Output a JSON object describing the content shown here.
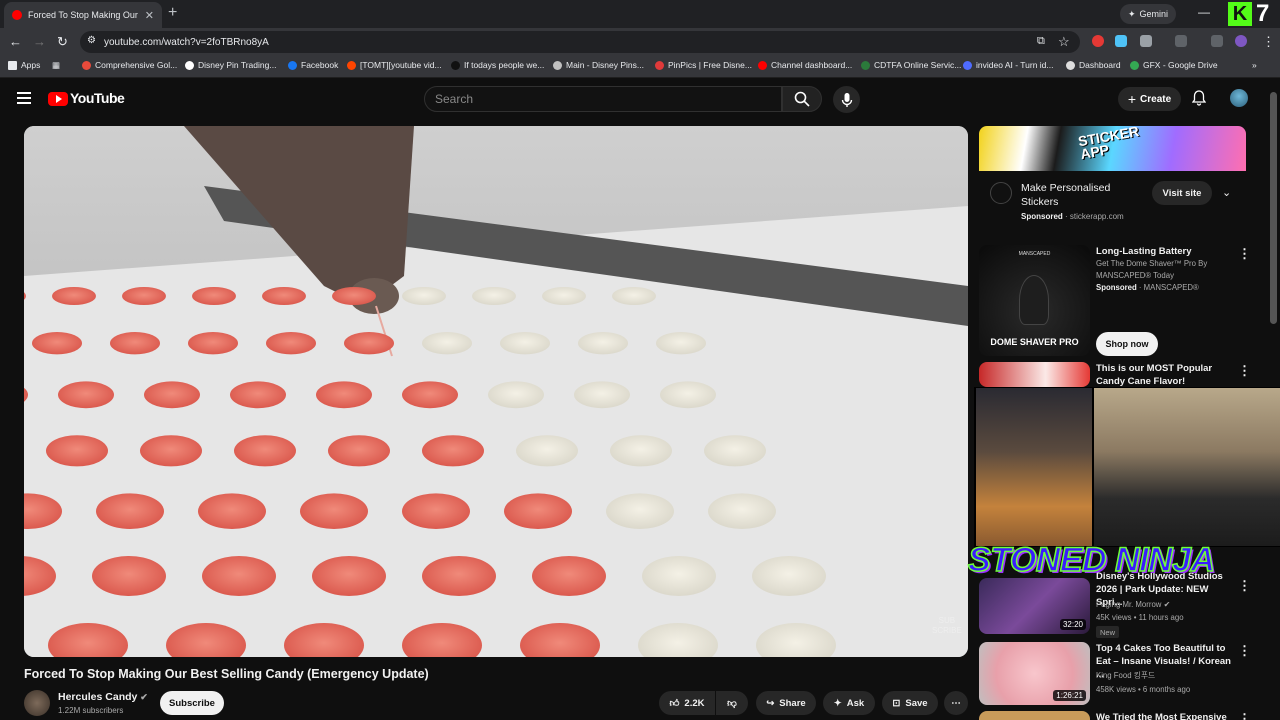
{
  "browser": {
    "tab_title": "Forced To Stop Making Our",
    "url": "youtube.com/watch?v=2foTBRno8yA",
    "gemini_label": "Gemini",
    "corner_number": "7",
    "bookmarks": [
      {
        "label": "Apps",
        "color": "#e8eaed"
      },
      {
        "label": "Comprehensive Gol...",
        "color": "#e84a3b"
      },
      {
        "label": "Disney Pin Trading...",
        "color": "#ffffff"
      },
      {
        "label": "Facebook",
        "color": "#1877f2"
      },
      {
        "label": "[TOMT][youtube vid...",
        "color": "#ff4500"
      },
      {
        "label": "If todays people we...",
        "color": "#111111"
      },
      {
        "label": "Main - Disney Pins...",
        "color": "#c0c0c0"
      },
      {
        "label": "PinPics | Free Disne...",
        "color": "#e03a3a"
      },
      {
        "label": "Channel dashboard...",
        "color": "#ff0000"
      },
      {
        "label": "CDTFA Online Servic...",
        "color": "#2b7a3b"
      },
      {
        "label": "invideo AI - Turn id...",
        "color": "#4f6cff"
      },
      {
        "label": "Dashboard",
        "color": "#dddddd"
      },
      {
        "label": "GFX - Google Drive",
        "color": "#34a853"
      }
    ]
  },
  "youtube": {
    "brand": "YouTube",
    "search_placeholder": "Search",
    "create_label": "Create"
  },
  "video": {
    "title": "Forced To Stop Making Our Best Selling Candy (Emergency Update)",
    "watermark": "SUB\nSCRIBE",
    "channel": "Hercules Candy",
    "subscribers": "1.22M subscribers",
    "subscribe_label": "Subscribe",
    "likes": "2.2K",
    "share_label": "Share",
    "ask_label": "Ask",
    "save_label": "Save"
  },
  "ad": {
    "banner_brand": "STICKER APP",
    "title": "Make Personalised Stickers",
    "sponsored": "Sponsored",
    "domain": "stickerapp.com",
    "visit_label": "Visit site"
  },
  "sidebar": [
    {
      "title": "Long-Lasting Battery",
      "sub1": "Get The Dome Shaver™ Pro By",
      "sub2": "MANSCAPED® Today",
      "sponsored": "Sponsored",
      "advertiser": "MANSCAPED®",
      "shop_label": "Shop now",
      "thumb_top": "MANSCAPED",
      "thumb_bottom": "DOME SHAVER PRO"
    },
    {
      "title": "This is our MOST Popular Candy Cane Flavor!"
    },
    {
      "title": "Disney's Hollywood Studios 2026 | Park Update: NEW Spri...",
      "channel": "Paging Mr. Morrow",
      "meta": "45K views • 11 hours ago",
      "badge": "New",
      "duration": "32:20"
    },
    {
      "title": "Top 4 Cakes Too Beautiful to Eat – Insane Visuals! / Korean ...",
      "channel": "King Food 킹푸드",
      "meta": "458K views • 6 months ago",
      "duration": "1:26:21"
    },
    {
      "title": "We Tried the Most Expensive"
    }
  ],
  "overlay": {
    "name": "STONED NINJA"
  }
}
